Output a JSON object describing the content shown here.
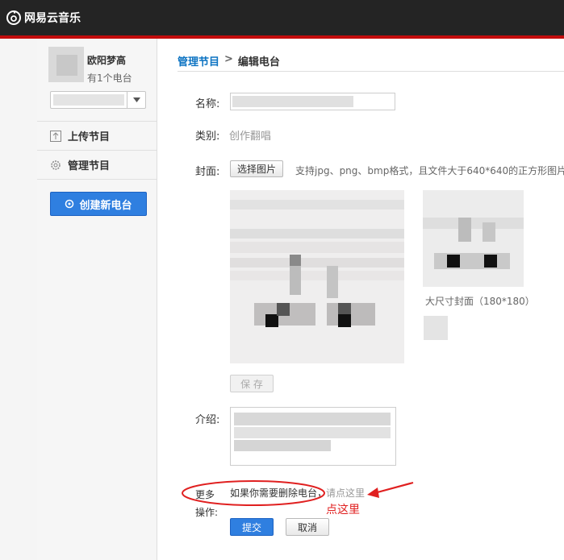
{
  "app": {
    "title": "网易云音乐",
    "accent": "#c20c0c"
  },
  "sidebar": {
    "username": "欧阳梦高",
    "radio_count": "有1个电台",
    "items": [
      {
        "label": "上传节目",
        "icon": "upload-icon"
      },
      {
        "label": "管理节目",
        "icon": "gear-icon"
      }
    ],
    "create_button": "创建新电台"
  },
  "breadcrumb": {
    "parent": "管理节目",
    "separator": ">",
    "current": "编辑电台"
  },
  "form": {
    "name_label": "名称:",
    "category_label": "类别:",
    "category_value": "创作翻唱",
    "cover_label": "封面:",
    "choose_image_button": "选择图片",
    "cover_hint": "支持jpg、png、bmp格式，且文件大于640*640的正方形图片",
    "large_cover_caption": "大尺寸封面（180*180）",
    "save_button": "保 存",
    "intro_label": "介绍:",
    "more_label": "更多操作:",
    "more_text": "如果你需要删除电台，",
    "more_link": "请点这里",
    "annotation": "点这里",
    "submit_button": "提交",
    "cancel_button": "取消"
  }
}
